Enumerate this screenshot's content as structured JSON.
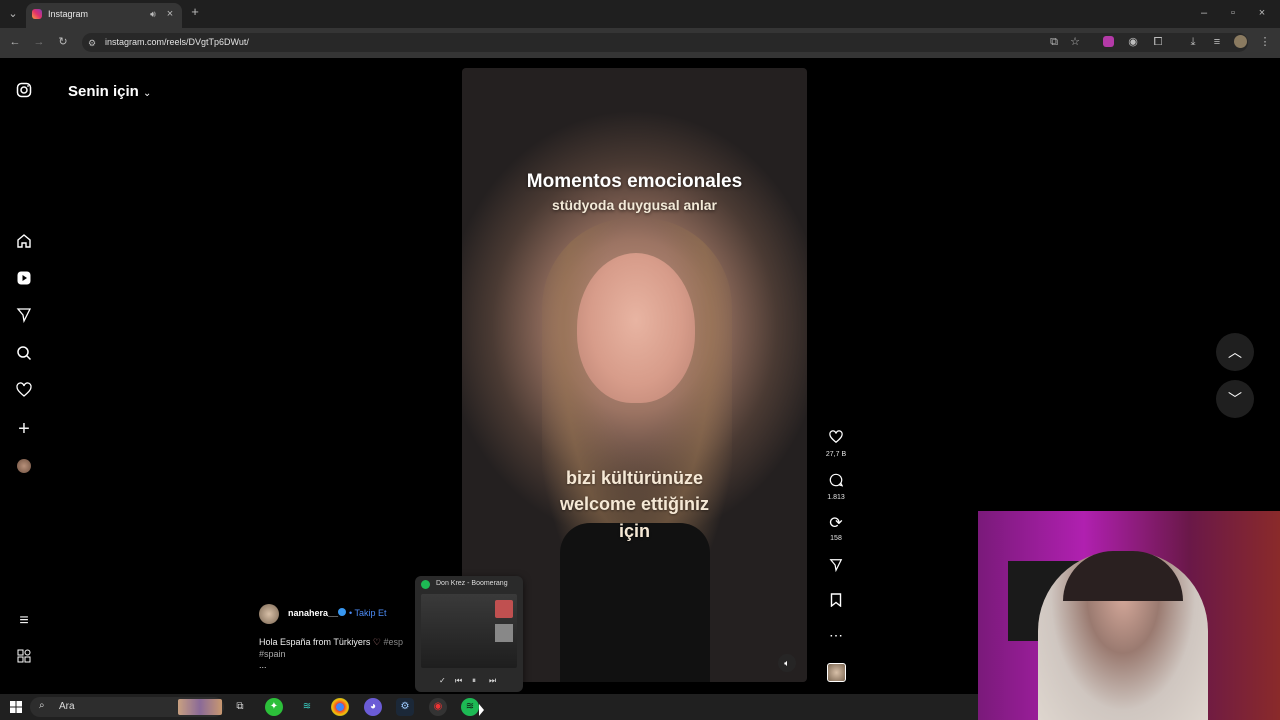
{
  "browser": {
    "tab_title": "Instagram",
    "url": "instagram.com/reels/DVgtTp6DWut/"
  },
  "instagram": {
    "feed_title": "Senin için",
    "video": {
      "caption_title": "Momentos emocionales",
      "caption_subtitle": "stüdyoda duygusal anlar",
      "overlay_line1": "bizi kültürünüze",
      "overlay_line2": "welcome ettiğiniz",
      "overlay_line3": "için"
    },
    "post": {
      "username": "nanahera__",
      "follow_label": "• Takip Et",
      "caption": "Hola España from Türkiyers",
      "caption_tags": "#esp",
      "hashtag": "#spain",
      "more": "..."
    },
    "actions": {
      "likes": "27,7 B",
      "comments": "1.813",
      "reposts": "158"
    }
  },
  "spotify_popup": {
    "track": "Don Krez - Boomerang"
  },
  "taskbar": {
    "search_label": "Ara"
  },
  "colors": {
    "verified": "#3897f0",
    "follow": "#4c8bf5",
    "spotify": "#1db954"
  }
}
